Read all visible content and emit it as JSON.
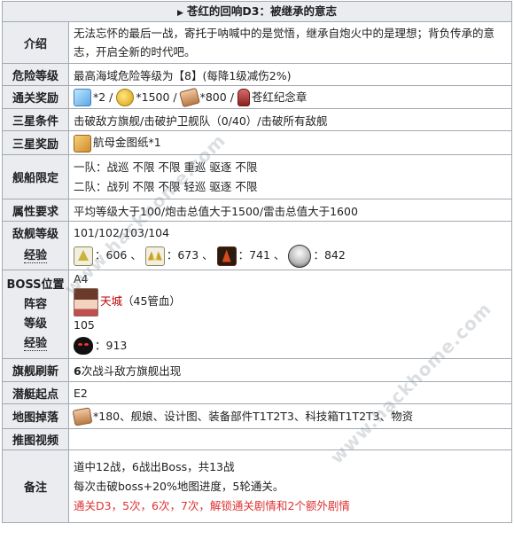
{
  "title": "苍红的回响D3：被继承的意志",
  "rows": {
    "intro": {
      "label": "介绍",
      "text": "无法忘怀的最后一战，寄托于呐喊中的是觉悟，继承自炮火中的是理想；背负传承的意志，开启全新的时代吧。"
    },
    "danger": {
      "label": "危险等级",
      "text": "最高海域危险等级为【8】(每降1级减伤2%)"
    },
    "clear_reward": {
      "label": "通关奖励",
      "cube": "*2 /",
      "coin": "*1500 /",
      "ticket": "*800 /",
      "medal": "苍红纪念章"
    },
    "star_cond": {
      "label": "三星条件",
      "text": "击破敌方旗舰/击破护卫舰队（0/40）/击破所有敌舰"
    },
    "star_reward": {
      "label": "三星奖励",
      "text": "航母金图纸*1"
    },
    "ship_limit": {
      "label": "舰船限定",
      "line1": "一队：战巡 不限 不限 重巡 驱逐 不限",
      "line2": "二队：战列 不限 不限 轻巡 驱逐 不限"
    },
    "attr": {
      "label": "属性要求",
      "text": "平均等级大于100/炮击总值大于1500/雷击总值大于1600"
    },
    "enemy": {
      "label1": "敌舰等级",
      "label2": "经验",
      "levels": "101/102/103/104",
      "exp1": "：606 、",
      "exp2": "：673 、",
      "exp3": "：741 、",
      "exp4": "：842"
    },
    "boss": {
      "l1": "BOSS位置",
      "l2": "阵容",
      "l3": "等级",
      "l4": "经验",
      "pos": "A4",
      "name": "天城",
      "hp": "（45管血）",
      "level": "105",
      "exp": "：913"
    },
    "flag": {
      "label": "旗舰刷新",
      "num": "6",
      "text": "次战斗敌方旗舰出现"
    },
    "sub": {
      "label": "潜艇起点",
      "text": "E2"
    },
    "drops": {
      "label": "地图掉落",
      "text": "*180、舰娘、设计图、装备部件T1T2T3、科技箱T1T2T3、物资"
    },
    "video": {
      "label": "推图视频",
      "text": ""
    },
    "notes": {
      "label": "备注",
      "line1": "道中12战，6战出Boss，共13战",
      "line2": "每次击破boss+20%地图进度，5轮通关。",
      "line3": "通关D3，5次，6次，7次，解锁通关剧情和2个额外剧情"
    }
  },
  "watermark": "www.hackhome.com",
  "icons": [
    "cube-icon",
    "coin-icon",
    "ticket-icon",
    "medal-icon",
    "blueprint-icon",
    "sig-icon",
    "boss-icon",
    "character-icon",
    "demon-icon",
    "box-icon"
  ]
}
